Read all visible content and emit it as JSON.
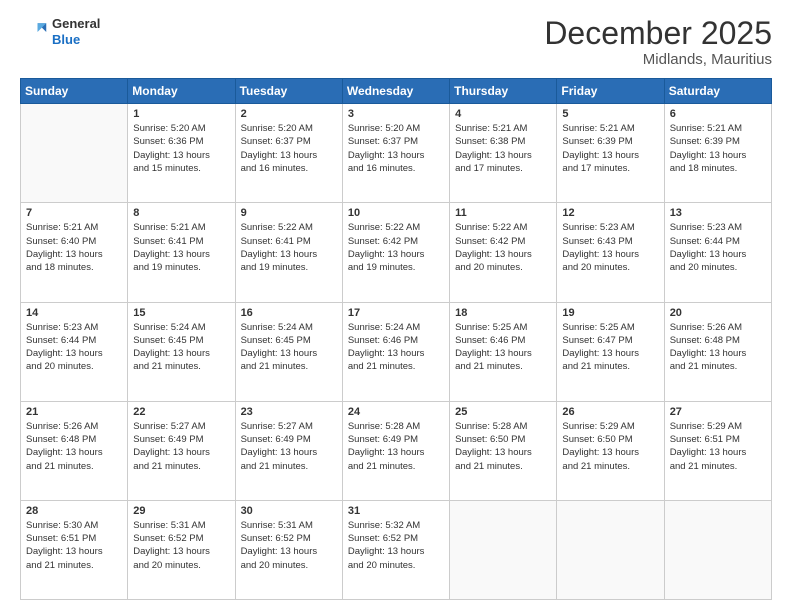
{
  "logo": {
    "general": "General",
    "blue": "Blue"
  },
  "header": {
    "title": "December 2025",
    "subtitle": "Midlands, Mauritius"
  },
  "weekdays": [
    "Sunday",
    "Monday",
    "Tuesday",
    "Wednesday",
    "Thursday",
    "Friday",
    "Saturday"
  ],
  "weeks": [
    [
      {
        "day": "",
        "info": ""
      },
      {
        "day": "1",
        "info": "Sunrise: 5:20 AM\nSunset: 6:36 PM\nDaylight: 13 hours\nand 15 minutes."
      },
      {
        "day": "2",
        "info": "Sunrise: 5:20 AM\nSunset: 6:37 PM\nDaylight: 13 hours\nand 16 minutes."
      },
      {
        "day": "3",
        "info": "Sunrise: 5:20 AM\nSunset: 6:37 PM\nDaylight: 13 hours\nand 16 minutes."
      },
      {
        "day": "4",
        "info": "Sunrise: 5:21 AM\nSunset: 6:38 PM\nDaylight: 13 hours\nand 17 minutes."
      },
      {
        "day": "5",
        "info": "Sunrise: 5:21 AM\nSunset: 6:39 PM\nDaylight: 13 hours\nand 17 minutes."
      },
      {
        "day": "6",
        "info": "Sunrise: 5:21 AM\nSunset: 6:39 PM\nDaylight: 13 hours\nand 18 minutes."
      }
    ],
    [
      {
        "day": "7",
        "info": "Sunrise: 5:21 AM\nSunset: 6:40 PM\nDaylight: 13 hours\nand 18 minutes."
      },
      {
        "day": "8",
        "info": "Sunrise: 5:21 AM\nSunset: 6:41 PM\nDaylight: 13 hours\nand 19 minutes."
      },
      {
        "day": "9",
        "info": "Sunrise: 5:22 AM\nSunset: 6:41 PM\nDaylight: 13 hours\nand 19 minutes."
      },
      {
        "day": "10",
        "info": "Sunrise: 5:22 AM\nSunset: 6:42 PM\nDaylight: 13 hours\nand 19 minutes."
      },
      {
        "day": "11",
        "info": "Sunrise: 5:22 AM\nSunset: 6:42 PM\nDaylight: 13 hours\nand 20 minutes."
      },
      {
        "day": "12",
        "info": "Sunrise: 5:23 AM\nSunset: 6:43 PM\nDaylight: 13 hours\nand 20 minutes."
      },
      {
        "day": "13",
        "info": "Sunrise: 5:23 AM\nSunset: 6:44 PM\nDaylight: 13 hours\nand 20 minutes."
      }
    ],
    [
      {
        "day": "14",
        "info": "Sunrise: 5:23 AM\nSunset: 6:44 PM\nDaylight: 13 hours\nand 20 minutes."
      },
      {
        "day": "15",
        "info": "Sunrise: 5:24 AM\nSunset: 6:45 PM\nDaylight: 13 hours\nand 21 minutes."
      },
      {
        "day": "16",
        "info": "Sunrise: 5:24 AM\nSunset: 6:45 PM\nDaylight: 13 hours\nand 21 minutes."
      },
      {
        "day": "17",
        "info": "Sunrise: 5:24 AM\nSunset: 6:46 PM\nDaylight: 13 hours\nand 21 minutes."
      },
      {
        "day": "18",
        "info": "Sunrise: 5:25 AM\nSunset: 6:46 PM\nDaylight: 13 hours\nand 21 minutes."
      },
      {
        "day": "19",
        "info": "Sunrise: 5:25 AM\nSunset: 6:47 PM\nDaylight: 13 hours\nand 21 minutes."
      },
      {
        "day": "20",
        "info": "Sunrise: 5:26 AM\nSunset: 6:48 PM\nDaylight: 13 hours\nand 21 minutes."
      }
    ],
    [
      {
        "day": "21",
        "info": "Sunrise: 5:26 AM\nSunset: 6:48 PM\nDaylight: 13 hours\nand 21 minutes."
      },
      {
        "day": "22",
        "info": "Sunrise: 5:27 AM\nSunset: 6:49 PM\nDaylight: 13 hours\nand 21 minutes."
      },
      {
        "day": "23",
        "info": "Sunrise: 5:27 AM\nSunset: 6:49 PM\nDaylight: 13 hours\nand 21 minutes."
      },
      {
        "day": "24",
        "info": "Sunrise: 5:28 AM\nSunset: 6:49 PM\nDaylight: 13 hours\nand 21 minutes."
      },
      {
        "day": "25",
        "info": "Sunrise: 5:28 AM\nSunset: 6:50 PM\nDaylight: 13 hours\nand 21 minutes."
      },
      {
        "day": "26",
        "info": "Sunrise: 5:29 AM\nSunset: 6:50 PM\nDaylight: 13 hours\nand 21 minutes."
      },
      {
        "day": "27",
        "info": "Sunrise: 5:29 AM\nSunset: 6:51 PM\nDaylight: 13 hours\nand 21 minutes."
      }
    ],
    [
      {
        "day": "28",
        "info": "Sunrise: 5:30 AM\nSunset: 6:51 PM\nDaylight: 13 hours\nand 21 minutes."
      },
      {
        "day": "29",
        "info": "Sunrise: 5:31 AM\nSunset: 6:52 PM\nDaylight: 13 hours\nand 20 minutes."
      },
      {
        "day": "30",
        "info": "Sunrise: 5:31 AM\nSunset: 6:52 PM\nDaylight: 13 hours\nand 20 minutes."
      },
      {
        "day": "31",
        "info": "Sunrise: 5:32 AM\nSunset: 6:52 PM\nDaylight: 13 hours\nand 20 minutes."
      },
      {
        "day": "",
        "info": ""
      },
      {
        "day": "",
        "info": ""
      },
      {
        "day": "",
        "info": ""
      }
    ]
  ]
}
